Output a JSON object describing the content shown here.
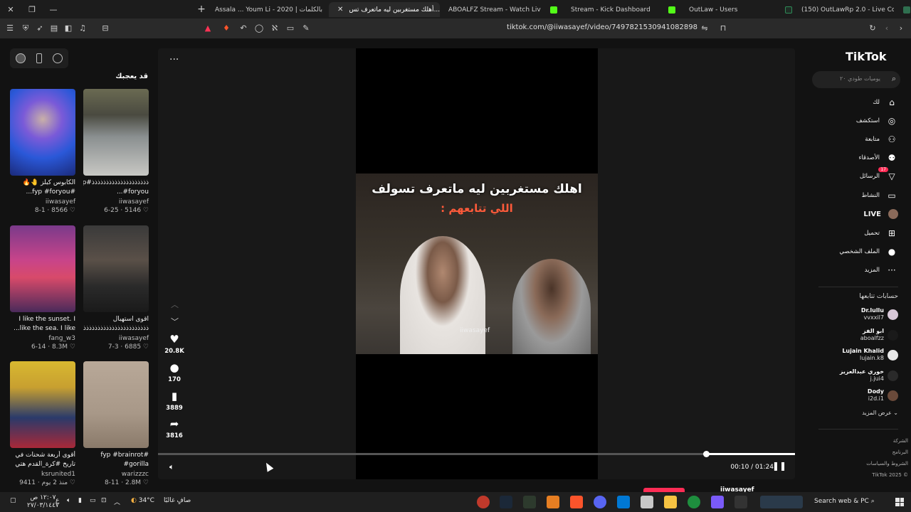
{
  "browser": {
    "tabs": [
      {
        "title": "Assala ... Youm Li - 2020 | بالكلمات - ...",
        "active": false
      },
      {
        "title": "أهلك مستغربين ليه ماتعرف تس...",
        "active": true
      },
      {
        "title": "ABOALFZ Stream - Watch Live on Kic",
        "active": false
      },
      {
        "title": "Stream - Kick Dashboard",
        "active": false
      },
      {
        "title": "OutLaw - Users",
        "active": false
      },
      {
        "title": "(150) OutLawRp 2.0 - Live Console",
        "active": false
      }
    ],
    "url": "tiktok.com/@iiwasayef/video/7497821530941082898"
  },
  "recommendations": {
    "title": "قد يعجبك",
    "items": [
      {
        "title": "الكابوس كبلز 🤚🔥 #fyp #foryou...",
        "author": "iiwasayef",
        "likes": "8566",
        "date": "8-1"
      },
      {
        "title": "ﺫﺫﺫﺫﺫﺫﺫﺫﺫﺫﺫﺫﺫﺫﺫﺫﺫﺫﺫﺫ#fyp #foryou...",
        "author": "iiwasayef",
        "likes": "5146",
        "date": "6-25"
      },
      {
        "title": "I like the sunset. I like the sea. I like...",
        "author": "fang_w3",
        "likes": "8.3M",
        "date": "6-14"
      },
      {
        "title": "اقوى استهبال ﺫﺫﺫﺫﺫﺫﺫﺫﺫﺫﺫﺫﺫﺫﺫﺫﺫﺫﺫﺫﺫﺫﺫ...",
        "author": "iiwasayef",
        "likes": "6885",
        "date": "7-3"
      },
      {
        "title": "أقوى أربعة شحنات في تاريخ #كرة_القدم هتي #فرو...4",
        "author": "ksrunited1",
        "likes": "9411",
        "date": "منذ 2 يوم"
      },
      {
        "title": "#fyp #brainrot #gorilla",
        "author": "warizzzc",
        "likes": "2.8M",
        "date": "8-11"
      }
    ]
  },
  "video": {
    "caption_line1": "اهلك مستغربين ليه ماتعرف تسولف",
    "caption_line2": "اللي تتابعهم :",
    "watermark": "iiwasayef",
    "likes": "20.8K",
    "comments": "170",
    "saves": "3889",
    "shares": "3816",
    "time": "00:10 / 01:24",
    "progress": 0.14,
    "author": "iiwasayef"
  },
  "sidebar": {
    "logo": "TikTok",
    "search_placeholder": "يوميات طودي ٢٠",
    "nav": [
      {
        "label": "لك",
        "icon": "home-icon"
      },
      {
        "label": "استكشف",
        "icon": "compass-icon"
      },
      {
        "label": "متابعة",
        "icon": "user-plus-icon"
      },
      {
        "label": "الأصدقاء",
        "icon": "friends-icon"
      },
      {
        "label": "الرسائل",
        "icon": "messages-icon",
        "badge": "17"
      },
      {
        "label": "النشاط",
        "icon": "activity-icon"
      },
      {
        "label": "LIVE",
        "icon": "live-icon"
      },
      {
        "label": "تحميل",
        "icon": "upload-icon"
      },
      {
        "label": "الملف الشخصي",
        "icon": "profile-icon"
      },
      {
        "label": "المزيد",
        "icon": "more-icon"
      }
    ],
    "following_title": "حسابات تتابعها",
    "following": [
      {
        "name": "Dr.lullu",
        "handle": "vvxxil7"
      },
      {
        "name": "ابو الفز",
        "handle": "aboalfzz"
      },
      {
        "name": "Lujain Khalid",
        "handle": "lujain.k8"
      },
      {
        "name": "خوري عبدالعزيز",
        "handle": "j.jui4"
      },
      {
        "name": "Dody",
        "handle": "i2d.i1"
      }
    ],
    "see_more": "عرض المزيد",
    "footer": [
      "الشركة",
      "البرنامج",
      "الشروط والسياسات",
      "TikTok 2025 ©"
    ]
  },
  "taskbar": {
    "weather": "34°C",
    "weather_text": "صافٍ غالبًا",
    "search": "Search web & PC",
    "time": "١٢:٠٧ ص",
    "date": "٢٧/٠٣/١٤٤٧"
  }
}
